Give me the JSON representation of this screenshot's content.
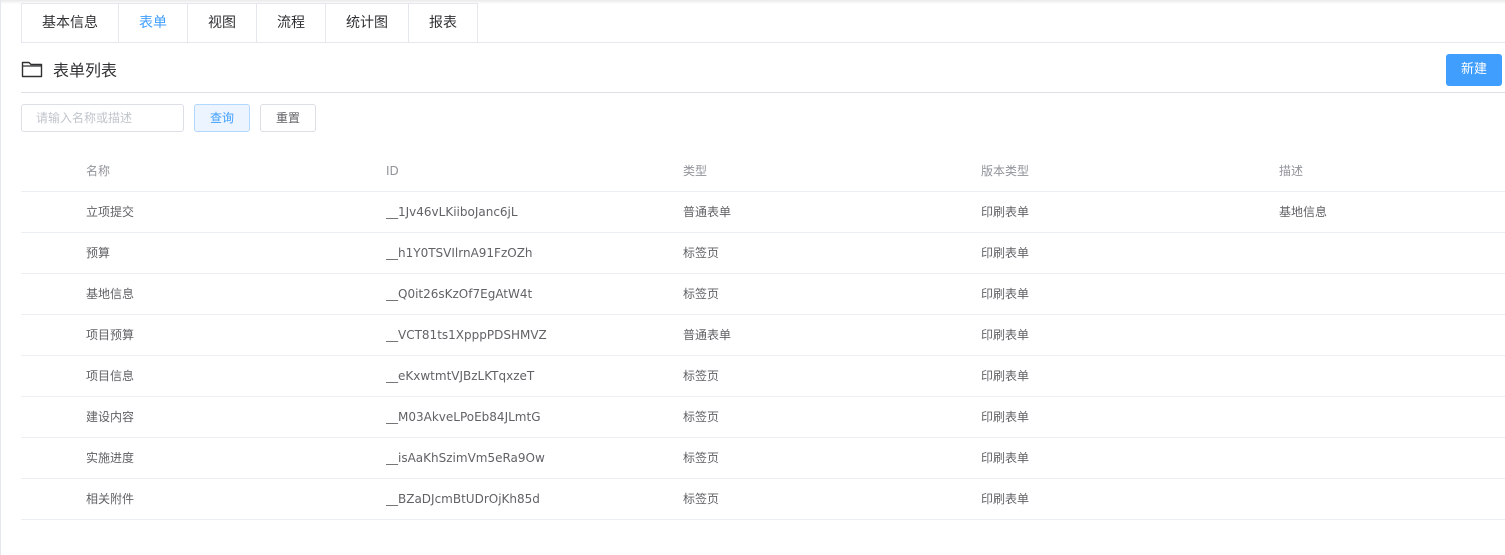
{
  "tabs": [
    {
      "label": "基本信息"
    },
    {
      "label": "表单"
    },
    {
      "label": "视图"
    },
    {
      "label": "流程"
    },
    {
      "label": "统计图"
    },
    {
      "label": "报表"
    }
  ],
  "active_tab": "表单",
  "section": {
    "title": "表单列表",
    "icon": "folder-icon"
  },
  "toolbar": {
    "new_label": "新建"
  },
  "search": {
    "placeholder": "请输入名称或描述",
    "value": "",
    "query_label": "查询",
    "reset_label": "重置"
  },
  "table": {
    "columns": [
      "名称",
      "ID",
      "类型",
      "版本类型",
      "描述"
    ],
    "rows": [
      [
        "立项提交",
        "__1Jv46vLKiiboJanc6jL",
        "普通表单",
        "印刷表单",
        "基地信息"
      ],
      [
        "预算",
        "__h1Y0TSVIlrnA91FzOZh",
        "标签页",
        "印刷表单",
        ""
      ],
      [
        "基地信息",
        "__Q0it26sKzOf7EgAtW4t",
        "标签页",
        "印刷表单",
        ""
      ],
      [
        "项目预算",
        "__VCT81ts1XpppPDSHMVZ",
        "普通表单",
        "印刷表单",
        ""
      ],
      [
        "项目信息",
        "__eKxwtmtVJBzLKTqxzeT",
        "标签页",
        "印刷表单",
        ""
      ],
      [
        "建设内容",
        "__M03AkveLPoEb84JLmtG",
        "标签页",
        "印刷表单",
        ""
      ],
      [
        "实施进度",
        "__isAaKhSzimVm5eRa9Ow",
        "标签页",
        "印刷表单",
        ""
      ],
      [
        "相关附件",
        "__BZaDJcmBtUDrOjKh85d",
        "标签页",
        "印刷表单",
        ""
      ]
    ]
  },
  "colors": {
    "accent": "#409eff",
    "text": "#606266",
    "header_text": "#909399",
    "border": "#ebeef5"
  }
}
